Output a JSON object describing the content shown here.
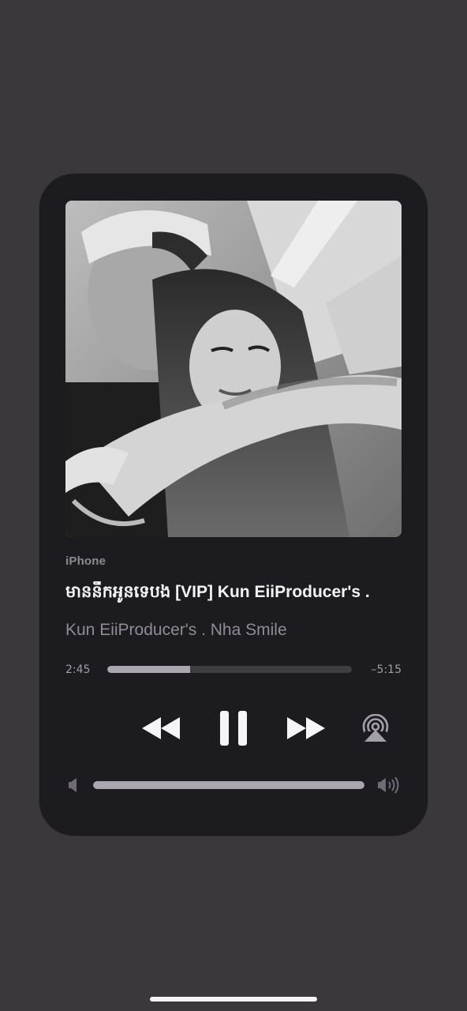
{
  "player": {
    "source": "iPhone",
    "title": "មាននឹកអូនទេបង [VIP] Kun EiiProducer's .",
    "artist": "Kun EiiProducer's . Nha Smile",
    "time_elapsed": "2:45",
    "time_remaining": "–5:15",
    "progress_fraction": 0.34,
    "volume_fraction": 1.0
  },
  "icons": {
    "rewind": "backward-fill-icon",
    "pause": "pause-fill-icon",
    "forward": "forward-fill-icon",
    "airplay": "airplay-audio-icon",
    "volume_low": "speaker-low-icon",
    "volume_high": "speaker-wave-icon"
  },
  "colors": {
    "background": "#3a383d",
    "card": "#1c1b1f",
    "primary_text": "#f4f4f6",
    "secondary_text": "#8f8d93",
    "track": "#3e3d42",
    "fill": "#a9a7ad"
  }
}
